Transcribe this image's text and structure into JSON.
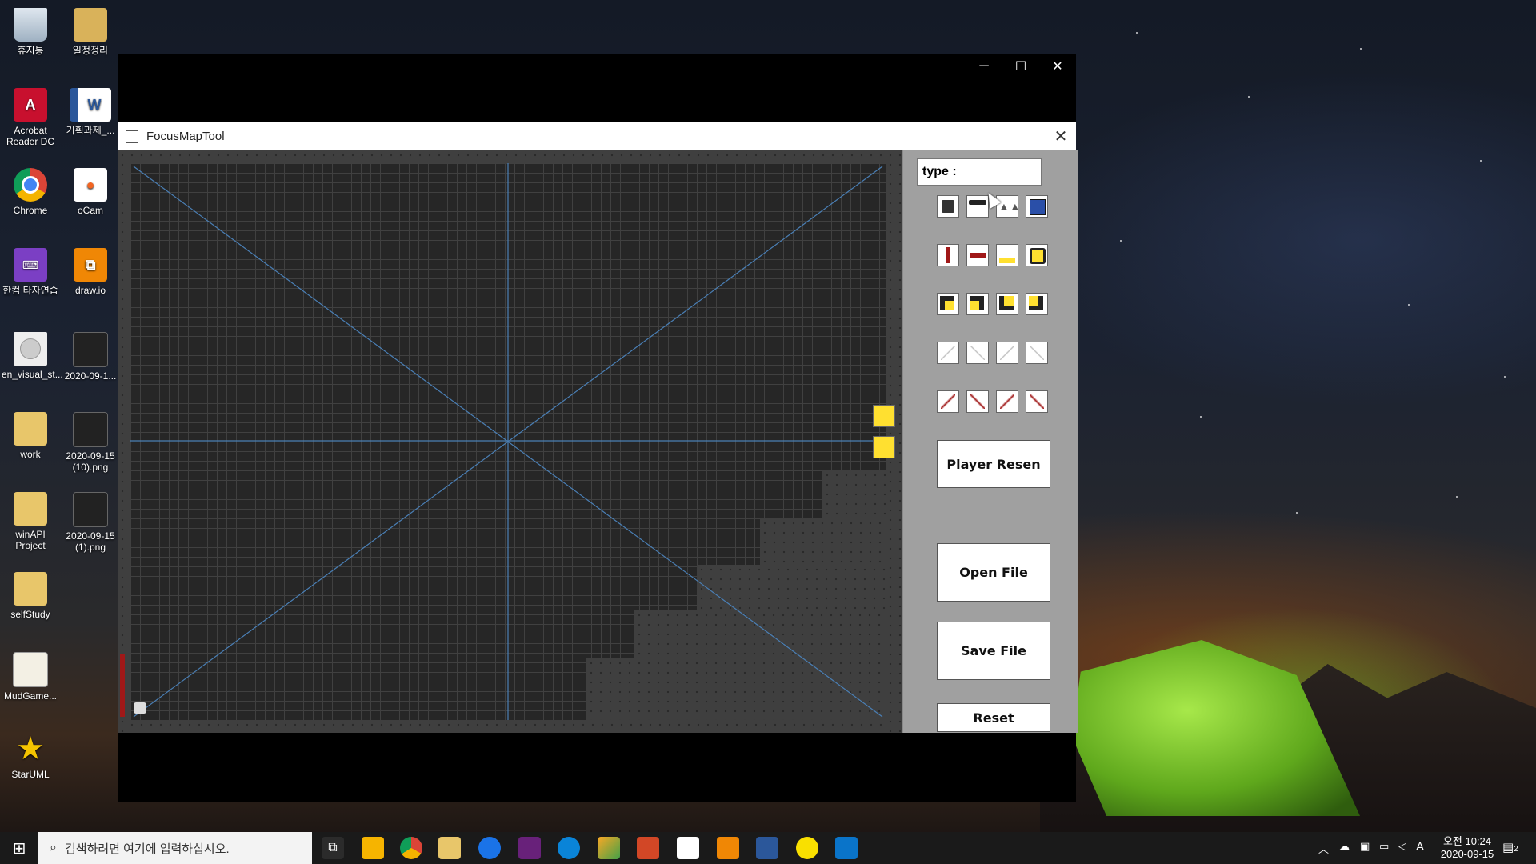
{
  "desktop": {
    "icons": [
      {
        "label": "휴지통"
      },
      {
        "label": "일정정리"
      },
      {
        "label": "Acrobat Reader DC"
      },
      {
        "label": "기획과제_..."
      },
      {
        "label": "Chrome"
      },
      {
        "label": "oCam"
      },
      {
        "label": "한컴 타자연습"
      },
      {
        "label": "draw.io"
      },
      {
        "label": "en_visual_st..."
      },
      {
        "label": "2020-09-1..."
      },
      {
        "label": "work"
      },
      {
        "label": "2020-09-15 (10).png"
      },
      {
        "label": "winAPI Project"
      },
      {
        "label": "2020-09-15 (1).png"
      },
      {
        "label": "selfStudy"
      },
      {
        "label": "MudGame..."
      },
      {
        "label": "StarUML"
      }
    ]
  },
  "window": {
    "controls": {
      "minimize": "─",
      "maximize": "☐",
      "close": "✕"
    }
  },
  "dialog": {
    "title": "FocusMapTool",
    "close": "✕",
    "type_label": "type :",
    "buttons": {
      "player_resen": "Player Resen",
      "open_file": "Open File",
      "save_file": "Save File",
      "reset": "Reset"
    },
    "accent_yellow": "#ffe030",
    "accent_red": "#a01818",
    "guide_line_color": "#4a7fb5"
  },
  "taskbar": {
    "search_placeholder": "검색하려면 여기에 입력하십시오.",
    "time": "오전 10:24",
    "date": "2020-09-15",
    "ime": "A",
    "notification_count": "2"
  }
}
